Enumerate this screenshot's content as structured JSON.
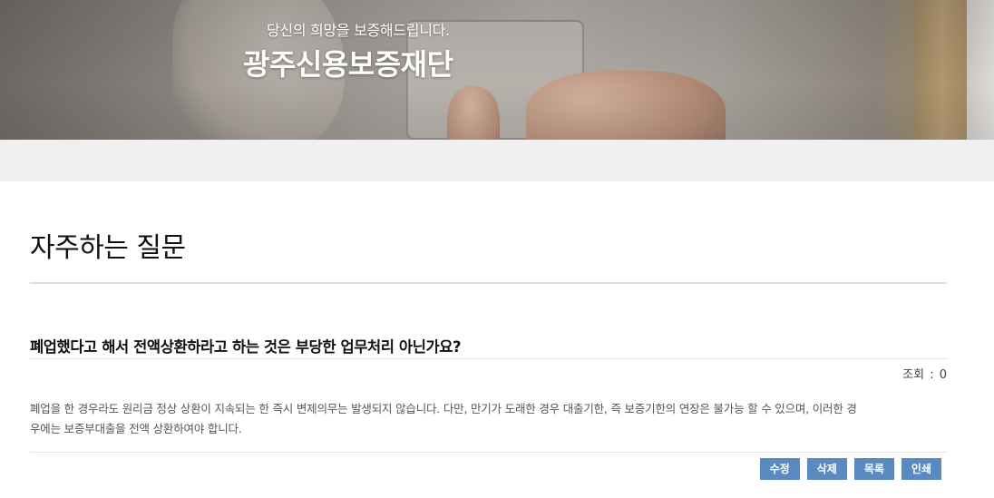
{
  "hero": {
    "subtitle": "당신의 희망을 보증해드립니다.",
    "title": "광주신용보증재단"
  },
  "page": {
    "title": "자주하는 질문"
  },
  "faq": {
    "question": "폐업했다고 해서 전액상환하라고 하는 것은 부당한 업무처리 아닌가요?",
    "views_label": "조회",
    "views_sep": ":",
    "views_count": "0",
    "answer_line1": "폐업을 한 경우라도 원리금 정상 상환이 지속되는 한 즉시 변제의무는 발생되지 않습니다. 다만, 만기가 도래한 경우 대출기한, 즉 보증기한의 연장은 불가능 할 수 있으며, 이러한 경",
    "answer_line2": "우에는 보증부대출을 전액 상환하여야 합니다."
  },
  "actions": {
    "edit": "수정",
    "delete": "삭제",
    "list": "목록",
    "print": "인쇄"
  },
  "colors": {
    "button_bg": "#5b8ac0",
    "band_bg": "#f0f0f0"
  }
}
